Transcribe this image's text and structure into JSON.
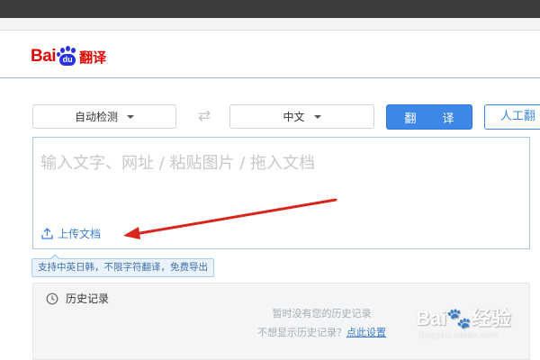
{
  "brand": {
    "logo_bai": "Bai",
    "logo_du": "du",
    "logo_suffix": "翻译"
  },
  "toolbar": {
    "source_lang": "自动检测",
    "swap_icon": "swap-arrows-icon",
    "target_lang": "中文",
    "translate_label": "翻　译",
    "human_label": "人工翻"
  },
  "input": {
    "placeholder": "输入文字、网址 / 粘贴图片 / 拖入文档",
    "upload_label": "上传文档",
    "upload_icon": "upload-icon"
  },
  "tooltip": {
    "text": "支持中英日韩，不限字符翻译，免费导出"
  },
  "history": {
    "title": "历史记录",
    "icon": "clock-icon",
    "empty_text": "暂时没有您的历史记录",
    "hint_prefix": "不想显示历史记录？",
    "hint_link": "点此设置"
  },
  "watermark": {
    "brand": "Bai",
    "brand_suffix": "经验",
    "url": "jingyan.baidu.com"
  },
  "colors": {
    "accent": "#3d88e6",
    "logo_red": "#e10602",
    "logo_blue": "#2932e1",
    "annotation_arrow": "#d9261c"
  }
}
